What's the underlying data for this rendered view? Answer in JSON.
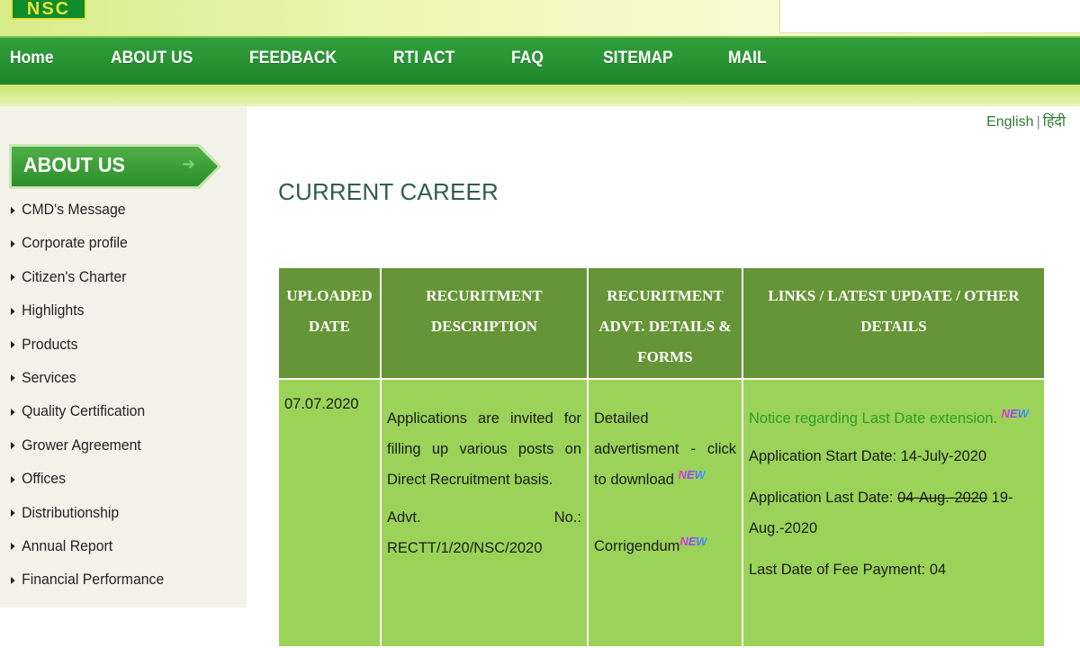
{
  "header": {
    "logo_text": "NSC",
    "nav": [
      "Home",
      "ABOUT US",
      "FEEDBACK",
      "RTI ACT",
      "FAQ",
      "SITEMAP",
      "MAIL"
    ]
  },
  "sidebar": {
    "heading": "ABOUT US",
    "items": [
      "CMD's Message",
      "Corporate profile",
      "Citizen's Charter",
      "Highlights",
      "Products",
      "Services",
      "Quality Certification",
      "Grower Agreement",
      "Offices",
      "Distributionship",
      "Annual Report",
      "Financial Performance"
    ]
  },
  "language": {
    "english": "English",
    "separator": "|",
    "hindi": "हिंदी"
  },
  "page": {
    "title": "CURRENT CAREER"
  },
  "table": {
    "headers": [
      "UPLOADED DATE",
      "RECURITMENT DESCRIPTION",
      "RECURITMENT ADVT. DETAILS & FORMS",
      "LINKS / LATEST UPDATE / OTHER DETAILS"
    ],
    "row": {
      "date": "07.07.2020",
      "description": "Applications are invited for filling up various posts on Direct Recruitment basis.",
      "advt_label": "Advt.",
      "advt_no_label": "No.:",
      "advt_number": "RECTT/1/20/NSC/2020",
      "adv_link": "Detailed advertisment - click to download",
      "corrigendum": "Corrigendum",
      "notice": "Notice regarding Last Date extension.",
      "start_date": "Application Start Date: 14-July-2020",
      "last_date_label": "Application Last Date:",
      "last_date_old": "04-Aug.-2020",
      "last_date_new": "19-Aug.-2020",
      "fee_line": "Last Date of Fee Payment: 04"
    },
    "new_badge": "NEW"
  },
  "colors": {
    "nav_green": "#2a9534",
    "header_cell": "#659536",
    "body_cell": "#9bd358",
    "link_green": "#2f9a2b"
  }
}
